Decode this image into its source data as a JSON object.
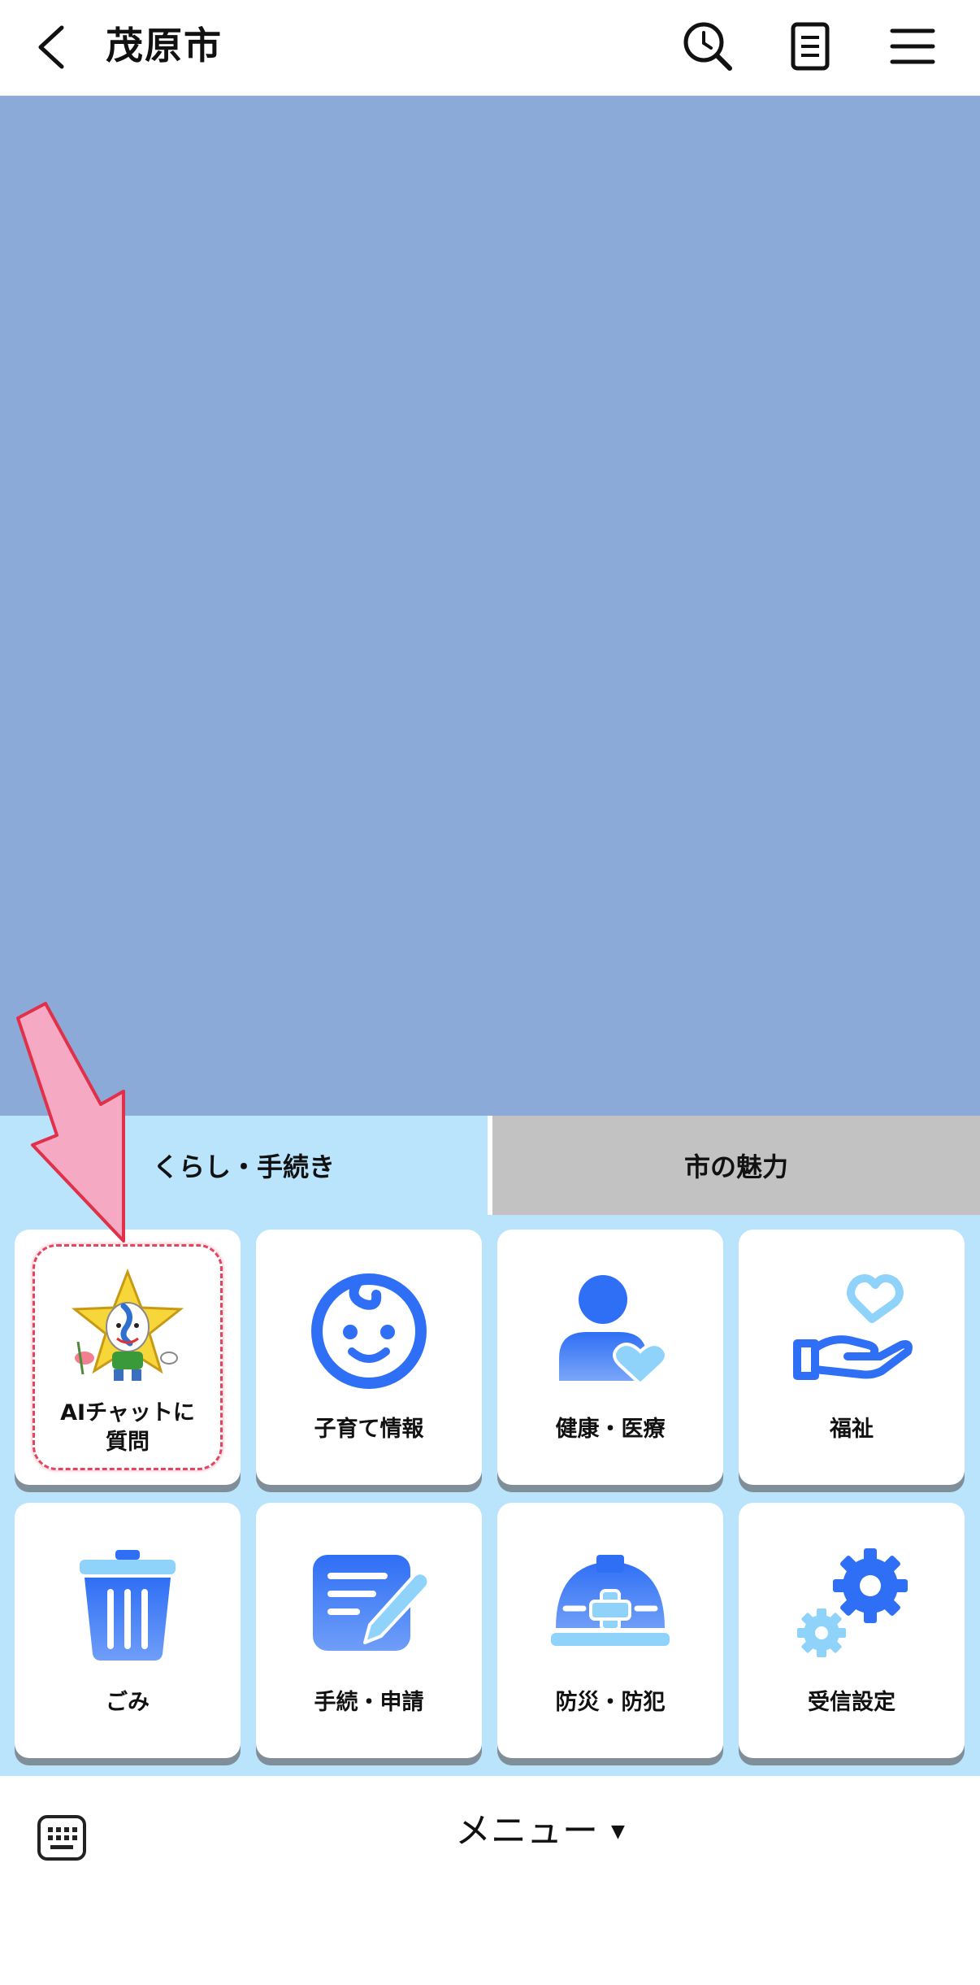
{
  "header": {
    "title": "茂原市",
    "back_icon": "chevron-left-icon",
    "icons": [
      "search-history-icon",
      "document-icon",
      "hamburger-menu-icon"
    ]
  },
  "tabs": [
    {
      "label": "くらし・手続き",
      "active": true
    },
    {
      "label": "市の魅力",
      "active": false
    }
  ],
  "tiles": [
    {
      "label_line1": "AIチャットに",
      "label_line2": "質問",
      "icon": "mascot-star-character"
    },
    {
      "label": "子育て情報",
      "icon": "baby-face-icon"
    },
    {
      "label": "健康・医療",
      "icon": "person-heart-icon"
    },
    {
      "label": "福祉",
      "icon": "hand-heart-icon"
    },
    {
      "label": "ごみ",
      "icon": "trash-can-icon"
    },
    {
      "label": "手続・申請",
      "icon": "document-pen-icon"
    },
    {
      "label": "防災・防犯",
      "icon": "helmet-cross-icon"
    },
    {
      "label": "受信設定",
      "icon": "gears-icon"
    }
  ],
  "footer": {
    "menu_label": "メニュー",
    "caret": "▼",
    "keyboard_icon": "keyboard-icon"
  },
  "colors": {
    "content_bg": "#8caad8",
    "panel_bg": "#b9e4fb",
    "inactive_tab": "#c2c2c2",
    "icon_blue": "#2f6ff5",
    "icon_light": "#8fd3fb",
    "arrow_fill": "#f6a9c2",
    "arrow_stroke": "#e0304a"
  }
}
